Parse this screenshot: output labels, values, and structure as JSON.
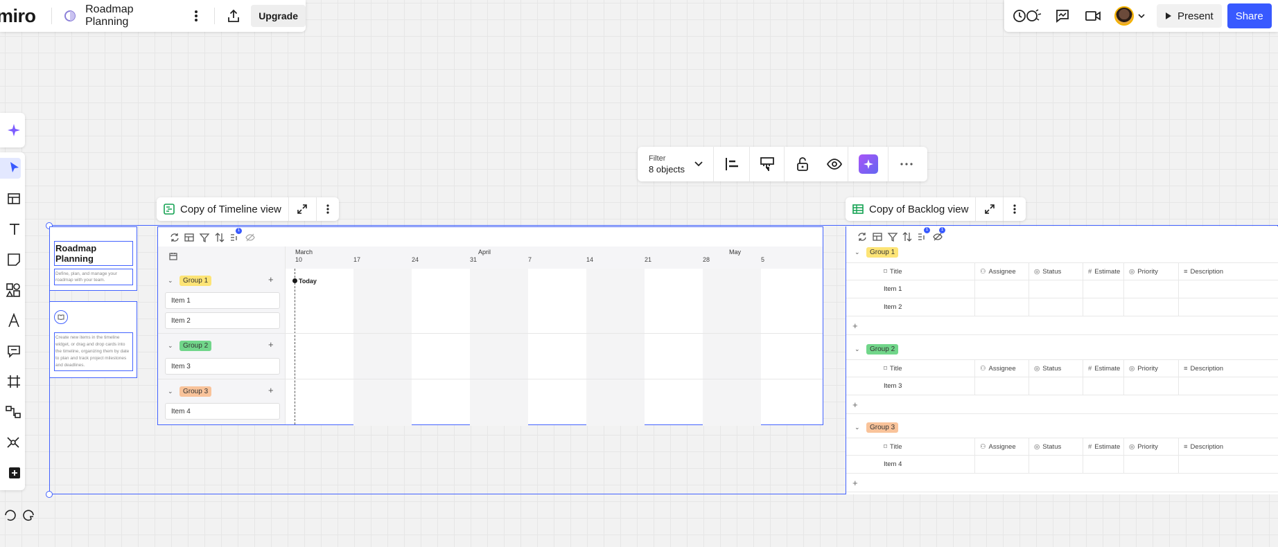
{
  "app": {
    "logo": "miro",
    "board_title": "Roadmap Planning",
    "upgrade_label": "Upgrade"
  },
  "topbar": {
    "present_label": "Present",
    "share_label": "Share"
  },
  "context_toolbar": {
    "filter_label": "Filter",
    "filter_value": "8 objects"
  },
  "intro_card": {
    "title": "Roadmap Planning",
    "subtitle": "Define, plan, and manage your roadmap with your team.",
    "tip": "Create new items in the timeline widget, or drag and drop cards into the timeline, organizing them by date to plan and track project milestones and deadlines."
  },
  "timeline": {
    "header_title": "Copy of Timeline view",
    "toolbar_badge": "1",
    "months": [
      "March",
      "April",
      "May"
    ],
    "weeks": [
      "10",
      "17",
      "24",
      "31",
      "7",
      "14",
      "21",
      "28",
      "5"
    ],
    "today_label": "Today",
    "groups": [
      {
        "name": "Group 1",
        "color": "#fde476",
        "items": [
          "Item 1",
          "Item 2"
        ]
      },
      {
        "name": "Group 2",
        "color": "#71d68a",
        "items": [
          "Item 3"
        ]
      },
      {
        "name": "Group 3",
        "color": "#f9c39a",
        "items": [
          "Item 4"
        ]
      }
    ]
  },
  "backlog": {
    "header_title": "Copy of Backlog view",
    "toolbar_badges": [
      "1",
      "1"
    ],
    "columns": [
      "Title",
      "Assignee",
      "Status",
      "Estimate",
      "Priority",
      "Description"
    ],
    "groups": [
      {
        "name": "Group 1",
        "color": "#fde476",
        "items": [
          "Item 1",
          "Item 2"
        ]
      },
      {
        "name": "Group 2",
        "color": "#71d68a",
        "items": [
          "Item 3"
        ]
      },
      {
        "name": "Group 3",
        "color": "#f9c39a",
        "items": [
          "Item 4"
        ]
      }
    ]
  },
  "colors": {
    "accent": "#3859ff",
    "selection": "#4262ff",
    "ai_gradient": "#a855f7"
  }
}
